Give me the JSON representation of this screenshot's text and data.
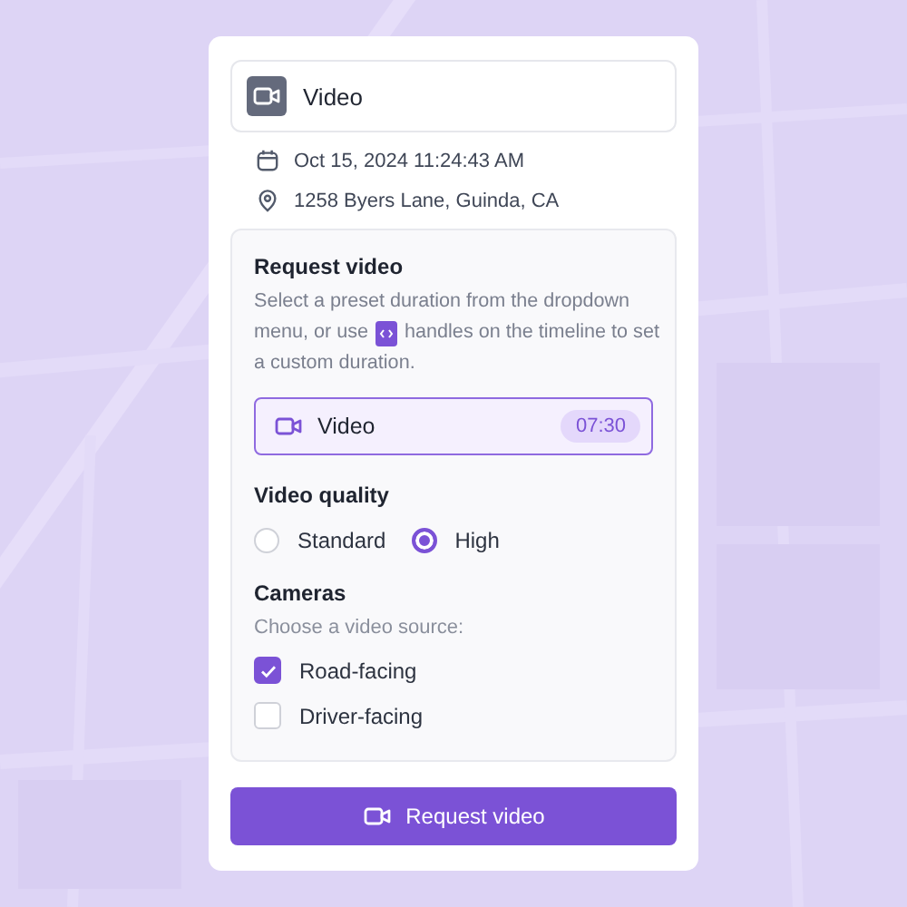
{
  "header": {
    "title": "Video"
  },
  "meta": [
    {
      "kind": "date",
      "text": "Oct 15, 2024 11:24:43 AM"
    },
    {
      "kind": "location",
      "text": "1258 Byers Lane, Guinda, CA"
    }
  ],
  "request": {
    "title": "Request video",
    "description_lines": [
      [
        {
          "kind": "text",
          "text": "Select a preset duration from the dropdown"
        }
      ],
      [
        {
          "kind": "text",
          "text": "menu, or use"
        },
        {
          "kind": "handles"
        },
        {
          "kind": "text",
          "text": "handles on the timeline to set"
        }
      ],
      [
        {
          "kind": "text",
          "text": "a custom duration."
        }
      ]
    ],
    "selector": {
      "label": "Video",
      "duration": "07:30"
    }
  },
  "quality": {
    "title": "Video quality",
    "options": [
      {
        "label": "Standard",
        "selected": false
      },
      {
        "label": "High",
        "selected": true
      }
    ]
  },
  "cameras": {
    "title": "Cameras",
    "hint": "Choose a video source:",
    "options": [
      {
        "label": "Road-facing",
        "checked": true
      },
      {
        "label": "Driver-facing",
        "checked": false
      }
    ]
  },
  "button": {
    "label": "Request video"
  }
}
